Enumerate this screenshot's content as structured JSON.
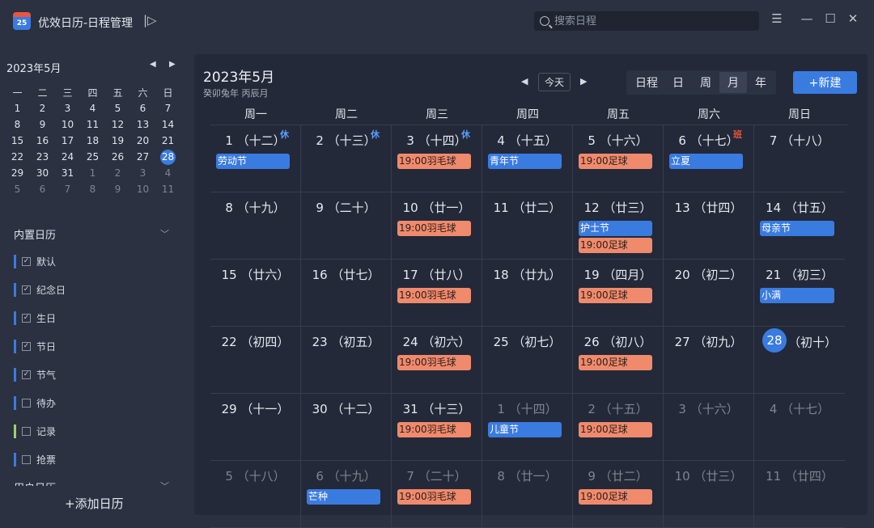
{
  "app": {
    "title": "优效日历-日程管理",
    "logo_text": "25"
  },
  "search": {
    "placeholder": "搜索日程"
  },
  "window": {
    "menu": "☰",
    "minimize": "—",
    "maximize": "☐",
    "close": "✕"
  },
  "mini_calendar": {
    "title": "2023年5月",
    "weekdays": [
      "一",
      "二",
      "三",
      "四",
      "五",
      "六",
      "日"
    ],
    "days": [
      {
        "d": "1"
      },
      {
        "d": "2"
      },
      {
        "d": "3"
      },
      {
        "d": "4"
      },
      {
        "d": "5"
      },
      {
        "d": "6"
      },
      {
        "d": "7"
      },
      {
        "d": "8"
      },
      {
        "d": "9"
      },
      {
        "d": "10"
      },
      {
        "d": "11"
      },
      {
        "d": "12"
      },
      {
        "d": "13"
      },
      {
        "d": "14"
      },
      {
        "d": "15"
      },
      {
        "d": "16"
      },
      {
        "d": "17"
      },
      {
        "d": "18"
      },
      {
        "d": "19"
      },
      {
        "d": "20"
      },
      {
        "d": "21"
      },
      {
        "d": "22"
      },
      {
        "d": "23"
      },
      {
        "d": "24"
      },
      {
        "d": "25"
      },
      {
        "d": "26"
      },
      {
        "d": "27"
      },
      {
        "d": "28",
        "today": true
      },
      {
        "d": "29"
      },
      {
        "d": "30"
      },
      {
        "d": "31"
      },
      {
        "d": "1",
        "dim": true
      },
      {
        "d": "2",
        "dim": true
      },
      {
        "d": "3",
        "dim": true
      },
      {
        "d": "4",
        "dim": true
      },
      {
        "d": "5",
        "dim": true
      },
      {
        "d": "6",
        "dim": true
      },
      {
        "d": "7",
        "dim": true
      },
      {
        "d": "8",
        "dim": true
      },
      {
        "d": "9",
        "dim": true
      },
      {
        "d": "10",
        "dim": true
      },
      {
        "d": "11",
        "dim": true
      }
    ]
  },
  "builtin_calendars": {
    "title": "内置日历",
    "items": [
      {
        "label": "默认",
        "color": "#3a7be0",
        "checked": true
      },
      {
        "label": "纪念日",
        "color": "#3a7be0",
        "checked": true
      },
      {
        "label": "生日",
        "color": "#3a7be0",
        "checked": true
      },
      {
        "label": "节日",
        "color": "#3a7be0",
        "checked": true
      },
      {
        "label": "节气",
        "color": "#3a7be0",
        "checked": true
      },
      {
        "label": "待办",
        "color": "#3a7be0",
        "checked": false
      },
      {
        "label": "记录",
        "color": "#9bd16b",
        "checked": false
      },
      {
        "label": "抢票",
        "color": "#3a7be0",
        "checked": false
      }
    ]
  },
  "user_calendars": {
    "title": "用户日历"
  },
  "add_calendar": "+添加日历",
  "main": {
    "month_title": "2023年5月",
    "lunar_subtitle": "癸卯兔年 丙辰月",
    "today_button": "今天",
    "views": [
      "日程",
      "日",
      "周",
      "月",
      "年"
    ],
    "active_view": "月",
    "new_button": "+新建",
    "weekdays": [
      "周一",
      "周二",
      "周三",
      "周四",
      "周五",
      "周六",
      "周日"
    ],
    "days": [
      {
        "label": "1 （十二）",
        "badge": "休",
        "events": [
          {
            "t": "劳动节",
            "c": "blue"
          }
        ]
      },
      {
        "label": "2 （十三）",
        "badge": "休",
        "events": []
      },
      {
        "label": "3 （十四）",
        "badge": "休",
        "events": [
          {
            "t": "19:00羽毛球",
            "c": "orange"
          }
        ]
      },
      {
        "label": "4 （十五）",
        "events": [
          {
            "t": "青年节",
            "c": "blue"
          }
        ]
      },
      {
        "label": "5 （十六）",
        "events": [
          {
            "t": "19:00足球",
            "c": "orange"
          }
        ]
      },
      {
        "label": "6 （十七）",
        "badge": "班",
        "events": [
          {
            "t": "立夏",
            "c": "blue"
          }
        ]
      },
      {
        "label": "7 （十八）",
        "events": []
      },
      {
        "label": "8 （十九）",
        "events": []
      },
      {
        "label": "9 （二十）",
        "events": []
      },
      {
        "label": "10 （廿一）",
        "events": [
          {
            "t": "19:00羽毛球",
            "c": "orange"
          }
        ]
      },
      {
        "label": "11 （廿二）",
        "events": []
      },
      {
        "label": "12 （廿三）",
        "events": [
          {
            "t": "护士节",
            "c": "blue"
          },
          {
            "t": "19:00足球",
            "c": "orange"
          }
        ]
      },
      {
        "label": "13 （廿四）",
        "events": []
      },
      {
        "label": "14 （廿五）",
        "events": [
          {
            "t": "母亲节",
            "c": "blue"
          }
        ]
      },
      {
        "label": "15 （廿六）",
        "events": []
      },
      {
        "label": "16 （廿七）",
        "events": []
      },
      {
        "label": "17 （廿八）",
        "events": [
          {
            "t": "19:00羽毛球",
            "c": "orange"
          }
        ]
      },
      {
        "label": "18 （廿九）",
        "events": []
      },
      {
        "label": "19 （四月）",
        "events": [
          {
            "t": "19:00足球",
            "c": "orange"
          }
        ]
      },
      {
        "label": "20 （初二）",
        "events": []
      },
      {
        "label": "21 （初三）",
        "events": [
          {
            "t": "小满",
            "c": "blue"
          }
        ]
      },
      {
        "label": "22 （初四）",
        "events": []
      },
      {
        "label": "23 （初五）",
        "events": []
      },
      {
        "label": "24 （初六）",
        "events": [
          {
            "t": "19:00羽毛球",
            "c": "orange"
          }
        ]
      },
      {
        "label": "25 （初七）",
        "events": []
      },
      {
        "label": "26 （初八）",
        "events": [
          {
            "t": "19:00足球",
            "c": "orange"
          }
        ]
      },
      {
        "label": "27 （初九）",
        "events": []
      },
      {
        "label": "（初十）",
        "today_num": "28",
        "events": []
      },
      {
        "label": "29 （十一）",
        "events": []
      },
      {
        "label": "30 （十二）",
        "events": []
      },
      {
        "label": "31 （十三）",
        "events": [
          {
            "t": "19:00羽毛球",
            "c": "orange"
          }
        ]
      },
      {
        "label": "1 （十四）",
        "dim": true,
        "events": [
          {
            "t": "儿童节",
            "c": "blue"
          }
        ]
      },
      {
        "label": "2 （十五）",
        "dim": true,
        "events": [
          {
            "t": "19:00足球",
            "c": "orange"
          }
        ]
      },
      {
        "label": "3 （十六）",
        "dim": true,
        "events": []
      },
      {
        "label": "4 （十七）",
        "dim": true,
        "events": []
      },
      {
        "label": "5 （十八）",
        "dim": true,
        "events": []
      },
      {
        "label": "6 （十九）",
        "dim": true,
        "events": [
          {
            "t": "芒种",
            "c": "blue"
          }
        ]
      },
      {
        "label": "7 （二十）",
        "dim": true,
        "events": [
          {
            "t": "19:00羽毛球",
            "c": "orange"
          }
        ]
      },
      {
        "label": "8 （廿一）",
        "dim": true,
        "events": []
      },
      {
        "label": "9 （廿二）",
        "dim": true,
        "events": [
          {
            "t": "19:00足球",
            "c": "orange"
          }
        ]
      },
      {
        "label": "10 （廿三）",
        "dim": true,
        "events": []
      },
      {
        "label": "11 （廿四）",
        "dim": true,
        "events": []
      }
    ]
  },
  "colors": {
    "accent": "#3a7be0",
    "event_orange": "#f08a6c",
    "rest_badge": "#5aa0ff",
    "work_badge": "#e8553e"
  }
}
